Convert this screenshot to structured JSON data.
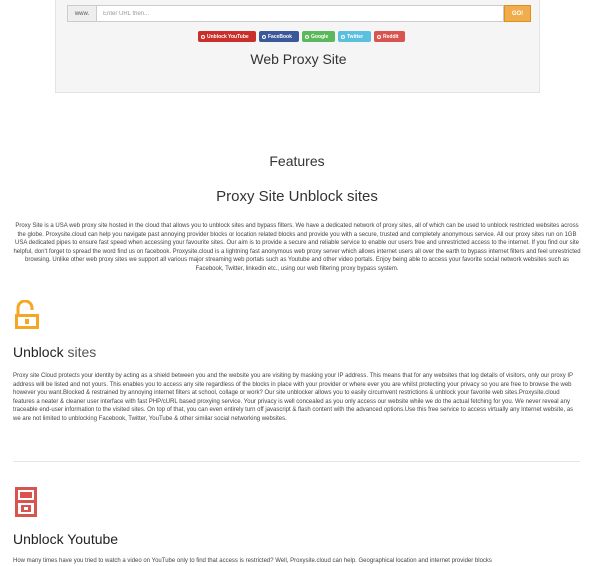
{
  "proxy": {
    "url_prefix": "www.",
    "url_placeholder": "Enter URL then...",
    "go_label": "GO!",
    "quick_links": [
      "Unblock YouTube",
      "FaceBook",
      "Google",
      "Twitter",
      "Reddit"
    ],
    "site_title": "Web Proxy Site"
  },
  "features": {
    "heading": "Features",
    "subtitle": "Proxy Site Unblock sites",
    "intro": "Proxy Site is a USA web proxy site hosted in the cloud that allows you to unblock sites and bypass filters. We have a dedicated network of proxy sites, all of which can be used to unblock restricted websites across the globe. Proxysite.cloud can help you navigate past annoying provider blocks or location related blocks and provide you with a secure, trusted and completely anonymous service. All our proxy sites run on 1GB USA dedicated pipes to ensure fast speed when accessing your favourite sites. Our aim is to provide a secure and reliable service to enable our users free and unrestricted access to the internet. If you find our site helpful, don't forget to spread the word find us on facebook. Proxysite.cloud is a lightning fast anonymous web proxy server which allows internet users all over the earth to bypass internet filters and feel unrestricted browsing. Unlike other web proxy sites we support all various major streaming web portals such as Youtube and other video portals. Enjoy being able to access your favorite social network websites such as Facebook, Twitter, linkedin etc., using our web filtering proxy bypass system."
  },
  "sections": {
    "sites": {
      "heading_main": "Unblock ",
      "heading_accent": "sites",
      "body": "Proxy site Cloud protects your identity by acting as a shield between you and the website you are visiting by masking your IP address. This means that for any websites that log details of visitors, only our proxy IP address will be listed and not yours. This enables you to access any site regardless of the blocks in place with your provider or where ever you are whilst protecting your privacy so you are free to browse the web however you want.Blocked & restrained by annoying internet filters at school, collage or work? Our site unblocker allows you to easily circumvent restrictions & unblock your favorite web sites.Proxysite.cloud features a neater & cleaner user interface with fast PHP/cURL based proxying service. Your privacy is well concealed as you only access our website while we do the actual fetching for you. We never reveal any traceable end-user information to the visited sites. On top of that, you can even entirely turn off javascript & flash content with the advanced options.Use this free service to access virtually any Internet website, as we are not limited to unblocking Facebook, Twitter, YouTube & other similar social networking websites."
    },
    "youtube": {
      "heading": "Unblock Youtube",
      "body": "How many times have you tried to watch a video on YouTube only to find that access is restricted? Well, Proxysite.cloud can help. Geographical location and internet provider blocks"
    }
  },
  "colors": {
    "accent_orange": "#f0ad4e",
    "icon_orange": "#f5a623",
    "icon_red": "#d9534f"
  }
}
